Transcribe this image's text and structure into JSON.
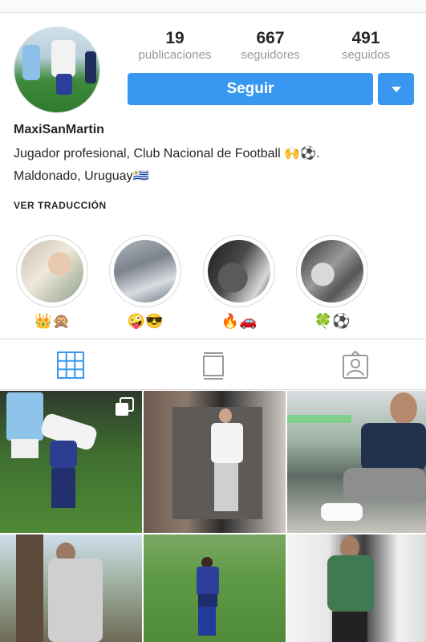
{
  "profile": {
    "username": "MaxiSanMartin",
    "bio_line1": "Jugador profesional, Club Nacional de Football 🙌⚽.",
    "bio_line2": "Maldonado, Uruguay🇺🇾",
    "translate_label": "VER TRADUCCIÓN"
  },
  "stats": [
    {
      "value": "19",
      "label": "publicaciones"
    },
    {
      "value": "667",
      "label": "seguidores"
    },
    {
      "value": "491",
      "label": "seguidos"
    }
  ],
  "actions": {
    "follow_label": "Seguir"
  },
  "highlights": [
    {
      "caption": "👑🙊"
    },
    {
      "caption": "🤪😎"
    },
    {
      "caption": "🔥🚗"
    },
    {
      "caption": "🍀⚽"
    }
  ],
  "tabs": [
    {
      "name": "grid",
      "active": true
    },
    {
      "name": "feed",
      "active": false
    },
    {
      "name": "tagged",
      "active": false
    }
  ],
  "colors": {
    "accent": "#3897f0",
    "muted": "#999999",
    "border": "#dbdbdb"
  }
}
